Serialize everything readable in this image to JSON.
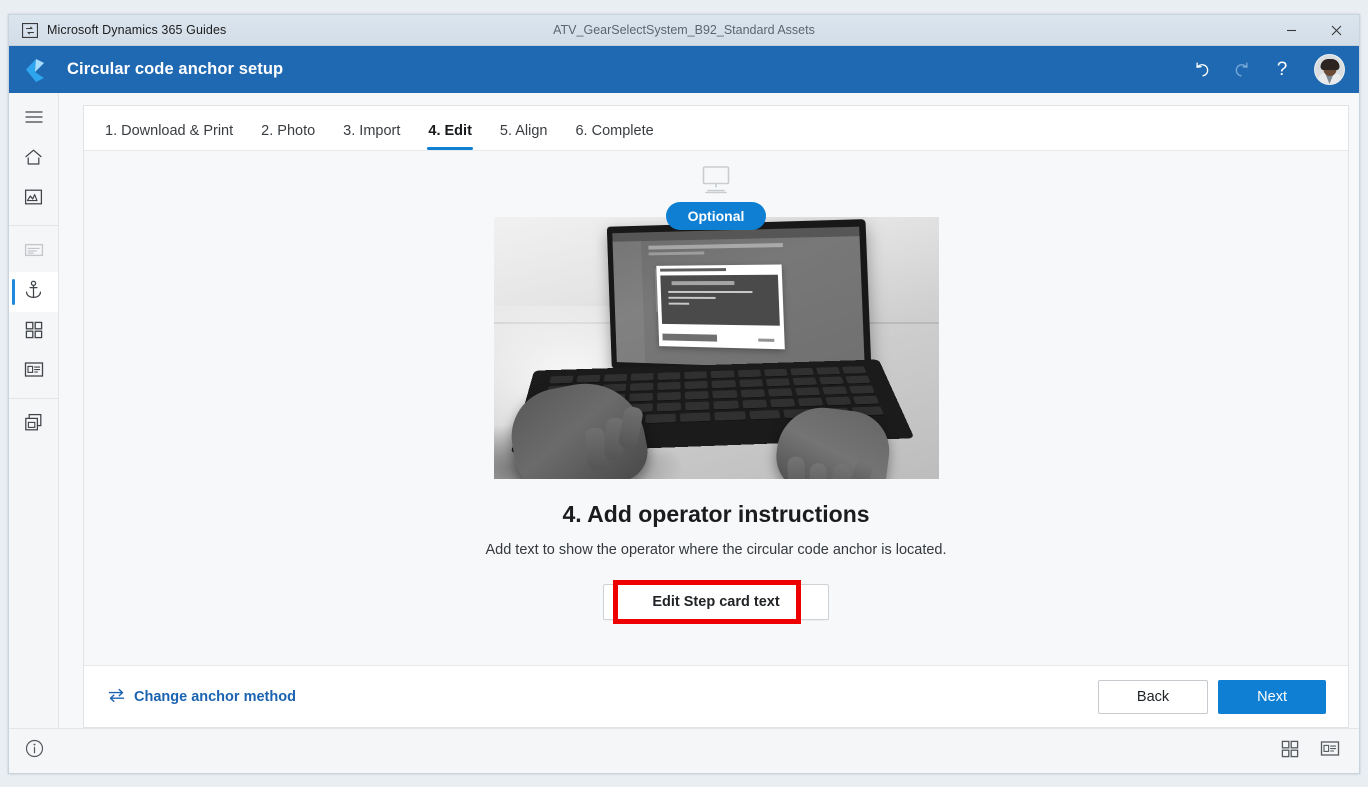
{
  "window": {
    "app_icon": "guides-app-icon",
    "app_name": "Microsoft Dynamics 365 Guides",
    "document_title": "ATV_GearSelectSystem_B92_Standard Assets",
    "minimize_label": "─",
    "close_label": "×"
  },
  "header": {
    "logo_icon": "dynamics-guides-logo",
    "title": "Circular code anchor setup",
    "undo_icon": "undo-icon",
    "redo_icon": "redo-icon",
    "help_label": "?",
    "avatar_icon": "user-avatar",
    "brand_color": "#1f69b3"
  },
  "sidebar": {
    "items": [
      {
        "name": "menu",
        "icon": "hamburger-menu-icon",
        "state": "default"
      },
      {
        "name": "home",
        "icon": "home-icon",
        "state": "default"
      },
      {
        "name": "media",
        "icon": "image-icon",
        "state": "default"
      },
      {
        "name": "outline",
        "icon": "text-lines-icon",
        "state": "disabled"
      },
      {
        "name": "anchor",
        "icon": "anchor-icon",
        "state": "active"
      },
      {
        "name": "steps-grid",
        "icon": "grid-four-squares-icon",
        "state": "default"
      },
      {
        "name": "step-card",
        "icon": "card-layout-icon",
        "state": "default"
      },
      {
        "name": "copy",
        "icon": "copy-pages-icon",
        "state": "default"
      }
    ]
  },
  "tabs": [
    {
      "label": "1. Download & Print",
      "active": false
    },
    {
      "label": "2. Photo",
      "active": false
    },
    {
      "label": "3. Import",
      "active": false
    },
    {
      "label": "4. Edit",
      "active": true
    },
    {
      "label": "5. Align",
      "active": false
    },
    {
      "label": "6. Complete",
      "active": false
    }
  ],
  "main": {
    "device_icon": "desktop-monitor-icon",
    "badge": "Optional",
    "badge_color": "#0f7fd4",
    "photo_alt": "Person typing on a laptop showing the Scan Printed Anchor dialog",
    "photo_screen": {
      "dialog_title": "Add anchoring instructions",
      "dialog_heading": "Scan Printed Anchor",
      "dialog_steps": [
        "1. Stand 1.5 feet in front of the printed anchor",
        "2. Select 'Initiate Scan'",
        "3. Look up"
      ],
      "dialog_primary": "Next",
      "dialog_secondary": "Cancel"
    },
    "title": "4. Add operator instructions",
    "description": "Add text to show the operator where the circular code anchor is located.",
    "edit_button": "Edit Step card text",
    "highlight_color": "#ee0000"
  },
  "footer": {
    "change_method_icon": "swap-arrows-icon",
    "change_method_label": "Change anchor method",
    "back_label": "Back",
    "next_label": "Next"
  },
  "statusbar": {
    "info_icon": "info-circle-icon",
    "grid_view_icon": "grid-four-squares-icon",
    "card_view_icon": "card-layout-icon"
  }
}
